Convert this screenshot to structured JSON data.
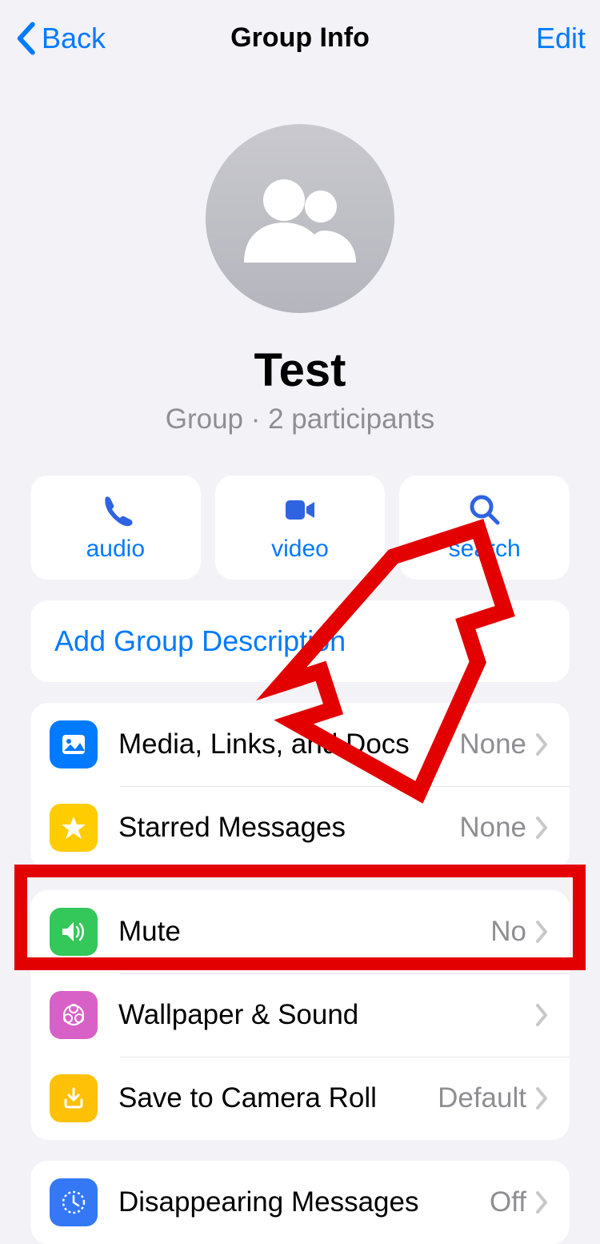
{
  "nav": {
    "back_label": "Back",
    "title": "Group Info",
    "edit_label": "Edit"
  },
  "group": {
    "name": "Test",
    "subtitle": "Group · 2 participants"
  },
  "actions": {
    "audio": "audio",
    "video": "video",
    "search": "search"
  },
  "description_link": "Add Group Description",
  "rows": {
    "media": {
      "label": "Media, Links, and Docs",
      "value": "None"
    },
    "starred": {
      "label": "Starred Messages",
      "value": "None"
    },
    "mute": {
      "label": "Mute",
      "value": "No"
    },
    "wallpaper": {
      "label": "Wallpaper & Sound",
      "value": ""
    },
    "save": {
      "label": "Save to Camera Roll",
      "value": "Default"
    },
    "disappearing": {
      "label": "Disappearing Messages",
      "value": "Off"
    }
  },
  "annotation": {
    "highlight_target": "mute-row",
    "box_color": "#e30000"
  }
}
